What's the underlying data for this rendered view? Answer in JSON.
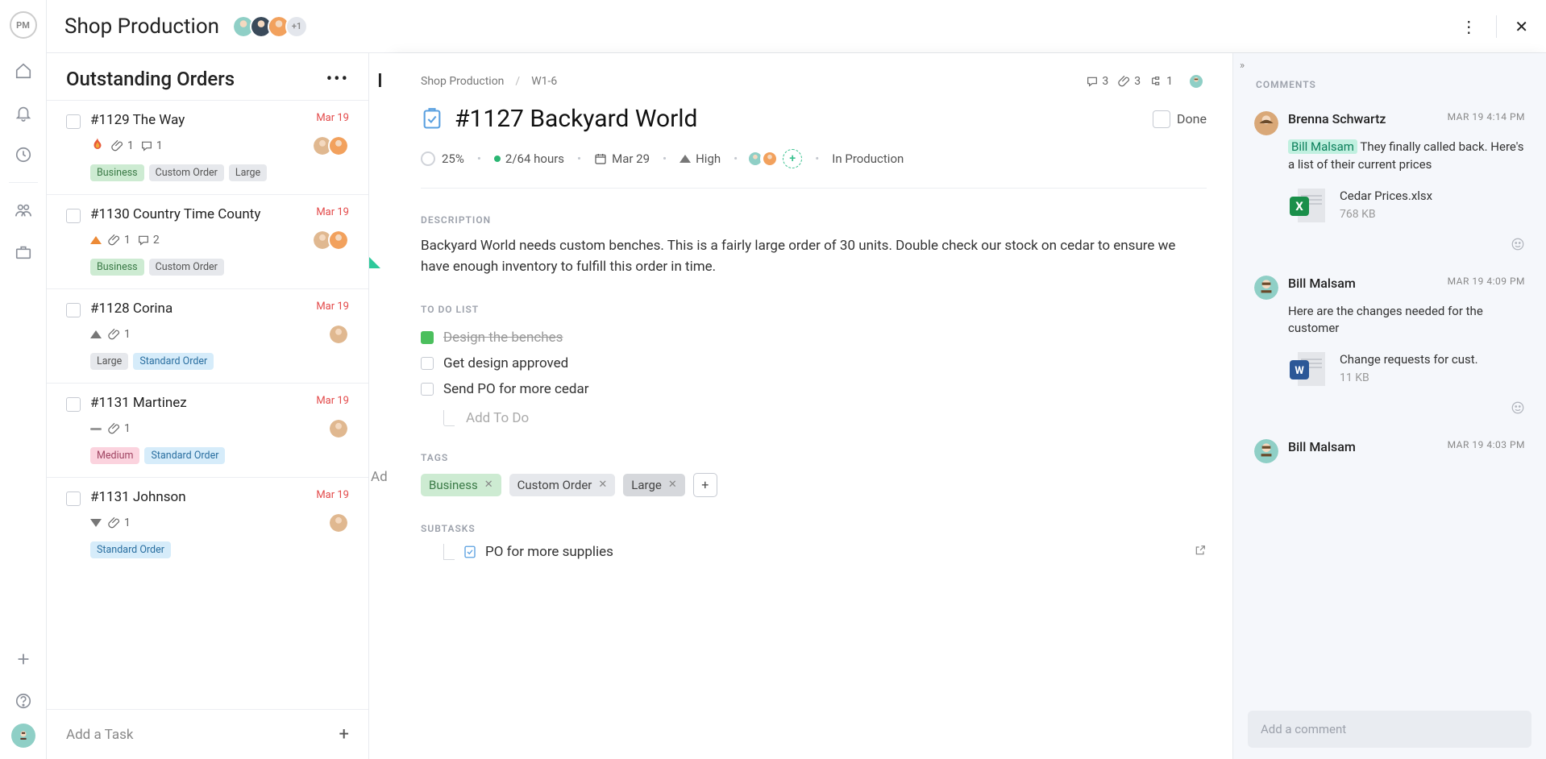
{
  "app": {
    "logo": "PM",
    "project_title": "Shop Production",
    "team_overflow": "+1"
  },
  "nav": {
    "items": [
      "home",
      "notifications",
      "recent",
      "team",
      "briefcase",
      "add"
    ],
    "help": "help"
  },
  "column": {
    "title": "Outstanding Orders",
    "add_placeholder": "Add a Task",
    "cards": [
      {
        "title": "#1129 The Way",
        "date": "Mar 19",
        "priority": "flame",
        "attach": 1,
        "comments": 1,
        "tags": [
          "Business",
          "Custom Order",
          "Large"
        ],
        "avatars": 2
      },
      {
        "title": "#1130 Country Time County",
        "date": "Mar 19",
        "priority": "urgent",
        "attach": 1,
        "comments": 2,
        "tags": [
          "Business",
          "Custom Order"
        ],
        "avatars": 2
      },
      {
        "title": "#1128 Corina",
        "date": "Mar 19",
        "priority": "high",
        "attach": 1,
        "tags": [
          "Large",
          "Standard Order"
        ],
        "avatars": 1
      },
      {
        "title": "#1131 Martinez",
        "date": "Mar 19",
        "priority": "none",
        "attach": 1,
        "tags": [
          "Medium",
          "Standard Order"
        ],
        "avatars": 1
      },
      {
        "title": "#1131 Johnson",
        "date": "Mar 19",
        "priority": "low",
        "attach": 1,
        "tags": [
          "Standard Order"
        ],
        "avatars": 1
      }
    ]
  },
  "column2": {
    "peek_head": "I",
    "peek_add": "Ad"
  },
  "task": {
    "breadcrumb": [
      "Shop Production",
      "W1-6"
    ],
    "counts": {
      "comments": 3,
      "attachments": 3,
      "subtasks": 1
    },
    "title": "#1127 Backyard World",
    "done_label": "Done",
    "percent": "25%",
    "hours": "2/64 hours",
    "due": "Mar 29",
    "priority": "High",
    "status": "In Production",
    "description": "Backyard World needs custom benches. This is a fairly large order of 30 units. Double check our stock on cedar to ensure we have enough inventory to fulfill this order in time.",
    "section_labels": {
      "desc": "DESCRIPTION",
      "todo": "TO DO LIST",
      "tags": "TAGS",
      "subtasks": "SUBTASKS"
    },
    "todos": [
      {
        "label": "Design the benches",
        "done": true
      },
      {
        "label": "Get design approved",
        "done": false
      },
      {
        "label": "Send PO for more cedar",
        "done": false
      }
    ],
    "add_todo_placeholder": "Add To Do",
    "tags": [
      "Business",
      "Custom Order",
      "Large"
    ],
    "subtask": "PO for more supplies"
  },
  "comments": {
    "heading": "COMMENTS",
    "add_placeholder": "Add a comment",
    "items": [
      {
        "author": "Brenna Schwartz",
        "time": "MAR 19 4:14 PM",
        "mention": "Bill Malsam",
        "text": " They finally called back. Here's a list of their current prices",
        "file": {
          "name": "Cedar Prices.xlsx",
          "size": "768 KB",
          "type": "x"
        }
      },
      {
        "author": "Bill Malsam",
        "time": "MAR 19 4:09 PM",
        "text": "Here are the changes needed for the customer",
        "file": {
          "name": "Change requests for cust.",
          "size": "11 KB",
          "type": "w"
        }
      },
      {
        "author": "Bill Malsam",
        "time": "MAR 19 4:03 PM"
      }
    ]
  }
}
